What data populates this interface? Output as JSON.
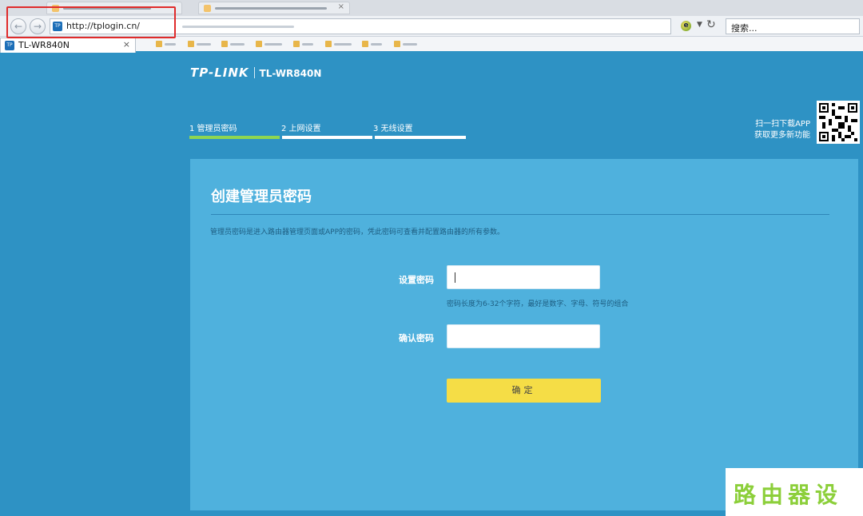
{
  "browser": {
    "url": "http://tplogin.cn/",
    "search_placeholder": "搜索...",
    "favicon_text": "TP",
    "active_tab_title": "TL-WR840N",
    "tab_close": "×"
  },
  "header": {
    "brand": "TP-LINK",
    "model": "TL-WR840N"
  },
  "steps": [
    {
      "label": "1 管理员密码",
      "active": true
    },
    {
      "label": "2 上网设置",
      "active": false
    },
    {
      "label": "3 无线设置",
      "active": false
    }
  ],
  "promo": {
    "line1": "扫一扫下载APP",
    "line2": "获取更多新功能"
  },
  "card": {
    "title": "创建管理员密码",
    "description": "管理员密码是进入路由器管理页面或APP的密码，凭此密码可查看并配置路由器的所有参数。",
    "password_label": "设置密码",
    "password_value": "",
    "password_hint": "密码长度为6-32个字符，最好是数字、字母、符号的组合",
    "confirm_label": "确认密码",
    "confirm_value": "",
    "submit_label": "确定"
  },
  "watermark": "路由器设置",
  "colors": {
    "page_bg": "#2e92c4",
    "card_bg": "#4fb1dd",
    "step_active": "#8ed651",
    "button": "#f5dd46",
    "highlight": "#e02b2b"
  }
}
